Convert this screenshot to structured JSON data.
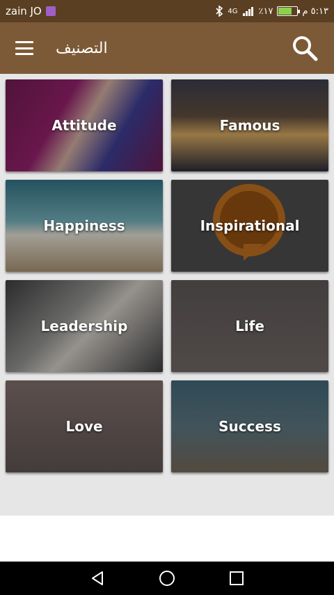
{
  "status_bar": {
    "carrier": "zain JO",
    "time": "٥:١٣ م",
    "battery_text": "٪١٧",
    "network": "4G",
    "battery_level": 0.65
  },
  "app_bar": {
    "title": "التصنيف",
    "menu_icon": "hamburger-icon",
    "search_icon": "search-icon"
  },
  "categories": [
    {
      "label": "Attitude"
    },
    {
      "label": "Famous"
    },
    {
      "label": "Happiness"
    },
    {
      "label": "Inspirational"
    },
    {
      "label": "Leadership"
    },
    {
      "label": "Life"
    },
    {
      "label": "Love"
    },
    {
      "label": "Success"
    }
  ],
  "nav_bar": {
    "back_icon": "back-triangle-icon",
    "home_icon": "home-circle-icon",
    "recents_icon": "recents-square-icon"
  },
  "colors": {
    "app_bar": "#7d5a37",
    "status_bar": "#5a3f22",
    "background": "#e6e6e6"
  }
}
